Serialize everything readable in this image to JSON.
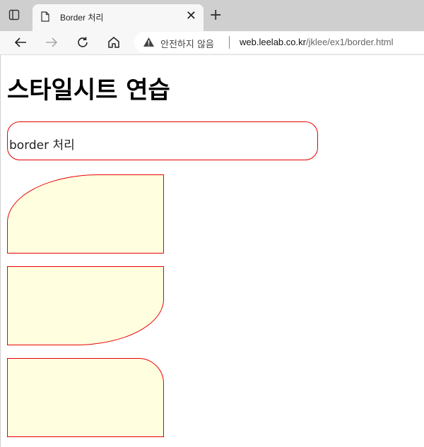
{
  "browser": {
    "tab_title": "Border 처리",
    "tab_close": "✕",
    "new_tab": "+",
    "address_warning": "안전하지 않음",
    "url_host": "web.leelab.co.kr",
    "url_path": "/jklee/ex1/border.html"
  },
  "page": {
    "heading": "스타일시트 연습",
    "border_box_text": "border 처리"
  },
  "colors": {
    "border": "#e60000",
    "box_fill": "#ffffdf"
  }
}
